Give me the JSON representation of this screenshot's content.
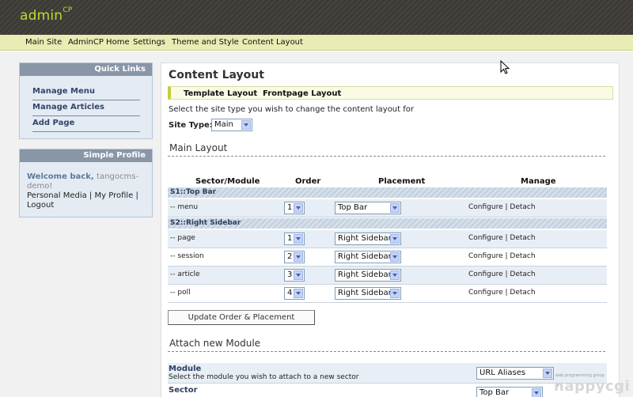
{
  "header": {
    "brand": "admin",
    "brand_sup": "CP"
  },
  "nav": [
    "Main Site",
    "AdminCP Home",
    "Settings",
    "Theme and Style",
    "Content Layout"
  ],
  "quick_links": {
    "title": "Quick Links",
    "items": [
      "Manage Menu",
      "Manage Articles",
      "Add Page"
    ]
  },
  "profile": {
    "title": "Simple Profile",
    "welcome": "Welcome back,",
    "username": "tangocms-demo!",
    "links": [
      "Personal Media",
      "My Profile",
      "Logout"
    ],
    "separator": "|"
  },
  "main": {
    "title": "Content Layout",
    "tabs": [
      "Template Layout",
      "Frontpage Layout"
    ],
    "instruction": "Select the site type you wish to change the content layout for",
    "site_type_label": "Site Type:",
    "site_type_value": "Main",
    "main_layout_title": "Main Layout",
    "columns": [
      "Sector/Module",
      "Order",
      "Placement",
      "Manage"
    ],
    "sectors": [
      {
        "name": "S1::Top Bar",
        "modules": [
          {
            "name": "-- menu",
            "order": "1",
            "placement": "Top Bar"
          }
        ]
      },
      {
        "name": "S2::Right Sidebar",
        "modules": [
          {
            "name": "-- page",
            "order": "1",
            "placement": "Right Sidebar"
          },
          {
            "name": "-- session",
            "order": "2",
            "placement": "Right Sidebar"
          },
          {
            "name": "-- article",
            "order": "3",
            "placement": "Right Sidebar"
          },
          {
            "name": "-- poll",
            "order": "4",
            "placement": "Right Sidebar"
          }
        ]
      }
    ],
    "manage_configure": "Configure",
    "manage_detach": "Detach",
    "manage_sep": "|",
    "update_button": "Update Order & Placement",
    "attach_title": "Attach new Module",
    "form": {
      "module_label": "Module",
      "module_desc": "Select the module you wish to attach to a new sector",
      "module_value": "URL Aliases",
      "sector_label": "Sector",
      "sector_value": "Top Bar"
    }
  },
  "watermark": {
    "small": "web programming group",
    "main": "nappycgi"
  },
  "colors": {
    "accent": "#c2da2f",
    "nav_bg": "#e9ecb3",
    "header_bg": "#3d3a36",
    "box_title": "#8996a8"
  }
}
